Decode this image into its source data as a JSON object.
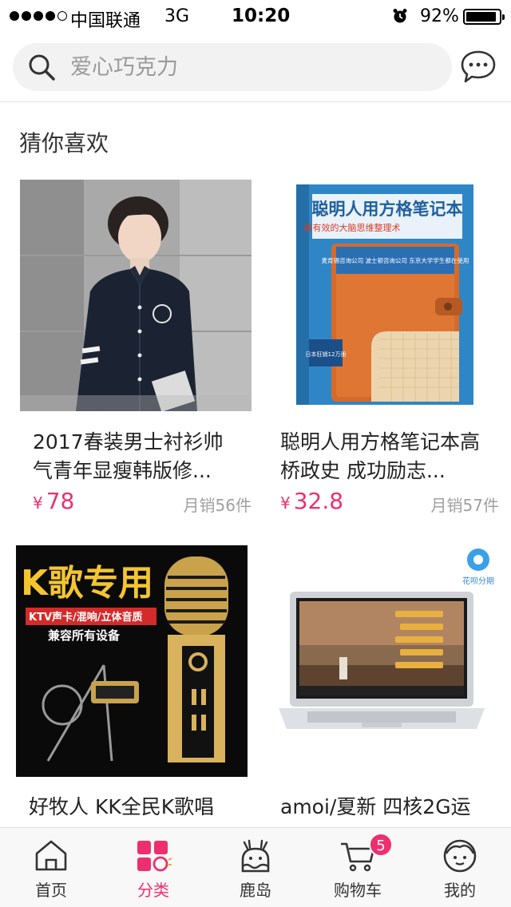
{
  "status_bar": {
    "carrier": "中国联通",
    "network": "3G",
    "time": "10:20",
    "battery_percent": "92%",
    "battery_level": 0.92
  },
  "search": {
    "placeholder": "爱心巧克力"
  },
  "section": {
    "title": "猜你喜欢"
  },
  "products": [
    {
      "name": "2017春装男士衬衫帅气青年显瘦韩版修...",
      "currency": "¥",
      "price": "78",
      "sales": "月销56件"
    },
    {
      "name": "聪明人用方格笔记本高桥政史 成功励志...",
      "currency": "¥",
      "price": "32.8",
      "sales": "月销57件"
    },
    {
      "name": "好牧人 KK全民K歌唱",
      "currency": "",
      "price": "",
      "sales": ""
    },
    {
      "name": "amoi/夏新 四核2G运",
      "currency": "",
      "price": "",
      "sales": ""
    }
  ],
  "product_images": {
    "book_title": "聪明人用方格笔记本",
    "book_subtitle": "最有效的大脑思维整理术",
    "book_band": "麦肯锡咨询公司 波士顿咨询公司 东京大学学生都在使用",
    "book_badge": "日本狂销12万册",
    "mic_title": "K歌专用",
    "mic_strip": "KTV声卡/混响/立体音质",
    "mic_caption": "兼容所有设备",
    "laptop_badge": "花呗分期"
  },
  "tabbar": {
    "items": [
      {
        "label": "首页",
        "icon": "home-icon"
      },
      {
        "label": "分类",
        "icon": "category-icon"
      },
      {
        "label": "鹿岛",
        "icon": "ludao-icon"
      },
      {
        "label": "购物车",
        "icon": "cart-icon"
      },
      {
        "label": "我的",
        "icon": "profile-icon"
      }
    ],
    "active_index": 1,
    "cart_badge": "5"
  },
  "colors": {
    "accent": "#ee2f6e",
    "search_bg": "#f2f2f2",
    "sales_text": "#a0a0a0"
  }
}
